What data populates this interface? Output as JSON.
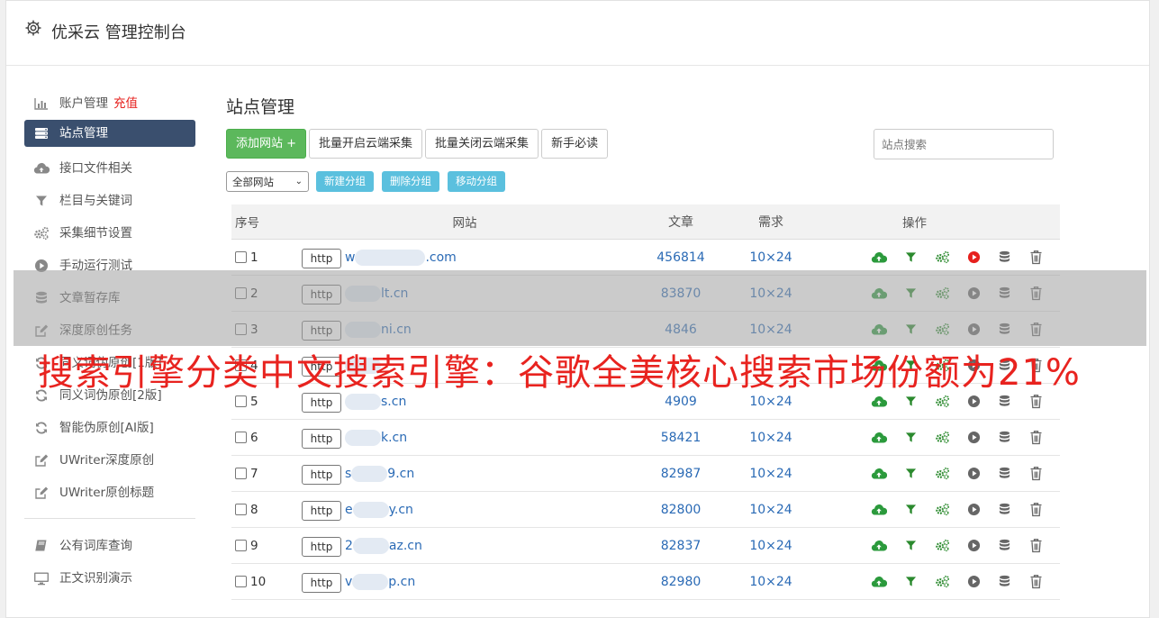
{
  "header": {
    "title": "优采云 管理控制台"
  },
  "sidebar": {
    "items": [
      {
        "label": "账户管理",
        "extra": "充值",
        "icon": "bar-chart-icon"
      },
      {
        "label": "站点管理",
        "icon": "server-icon",
        "active": true
      },
      {
        "label": "接口文件相关",
        "icon": "cloud-upload-icon"
      },
      {
        "label": "栏目与关键词",
        "icon": "filter-icon"
      },
      {
        "label": "采集细节设置",
        "icon": "cogs-icon"
      },
      {
        "label": "手动运行测试",
        "icon": "play-icon"
      },
      {
        "label": "文章暂存库",
        "icon": "database-icon"
      },
      {
        "label": "深度原创任务",
        "icon": "edit-icon"
      },
      {
        "label": "同义词伪原创[1版]",
        "icon": "refresh-icon"
      },
      {
        "label": "同义词伪原创[2版]",
        "icon": "refresh-icon"
      },
      {
        "label": "智能伪原创[AI版]",
        "icon": "refresh-icon"
      },
      {
        "label": "UWriter深度原创",
        "icon": "edit-icon"
      },
      {
        "label": "UWriter原创标题",
        "icon": "edit-icon"
      }
    ],
    "bottom_items": [
      {
        "label": "公有词库查询",
        "icon": "book-icon"
      },
      {
        "label": "正文识别演示",
        "icon": "monitor-icon"
      }
    ]
  },
  "main": {
    "title": "站点管理",
    "buttons": {
      "add": "添加网站 +",
      "batch_open": "批量开启云端采集",
      "batch_close": "批量关闭云端采集",
      "guide": "新手必读"
    },
    "search_placeholder": "站点搜索",
    "group_select": "全部网站",
    "group_buttons": {
      "new": "新建分组",
      "delete": "删除分组",
      "move": "移动分组"
    },
    "table": {
      "headers": {
        "no": "序号",
        "site": "网站",
        "articles": "文章",
        "demand": "需求",
        "ops": "操作"
      },
      "http_label": "http",
      "rows": [
        {
          "no": "1",
          "url": ".com",
          "prefix": "w",
          "articles": "456814",
          "demand": "10×24"
        },
        {
          "no": "2",
          "url": "lt.cn",
          "prefix": "",
          "articles": "83870",
          "demand": "10×24"
        },
        {
          "no": "3",
          "url": "ni.cn",
          "prefix": "",
          "articles": "4846",
          "demand": "10×24"
        },
        {
          "no": "4",
          "url": "",
          "prefix": "",
          "articles": "",
          "demand": ""
        },
        {
          "no": "5",
          "url": "s.cn",
          "prefix": "",
          "articles": "4909",
          "demand": "10×24"
        },
        {
          "no": "6",
          "url": "k.cn",
          "prefix": "",
          "articles": "58421",
          "demand": "10×24"
        },
        {
          "no": "7",
          "url": "9.cn",
          "prefix": "s",
          "articles": "82987",
          "demand": "10×24"
        },
        {
          "no": "8",
          "url": "y.cn",
          "prefix": "e",
          "articles": "82800",
          "demand": "10×24"
        },
        {
          "no": "9",
          "url": "az.cn",
          "prefix": "2",
          "articles": "82837",
          "demand": "10×24"
        },
        {
          "no": "10",
          "url": "p.cn",
          "prefix": "v",
          "articles": "82980",
          "demand": "10×24"
        }
      ]
    }
  },
  "banner": "搜索引擎分类中文搜索引擎：谷歌全美核心搜索市场份额为21%",
  "colors": {
    "active_bg": "#3a4f6e",
    "green": "#5cb85c",
    "info": "#5bc0de",
    "link": "#2a6ab5",
    "banner": "#e8231f",
    "play_active": "#e6201d"
  }
}
